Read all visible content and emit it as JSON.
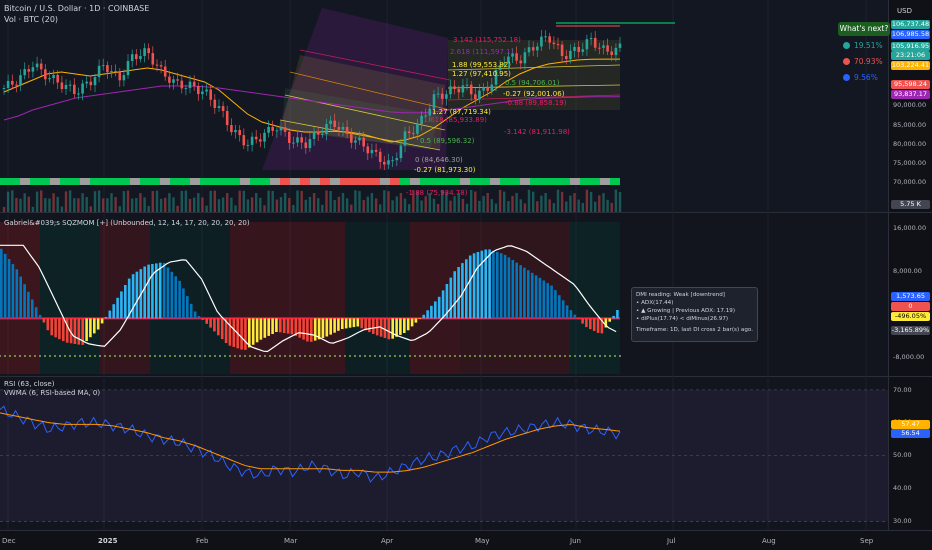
{
  "header": {
    "symbol_line": "Bitcoin / U.S. Dollar · 1D · COINBASE",
    "volume_label": "Vol · BTC (20)",
    "currency": "USD"
  },
  "whats_next": {
    "label": "What's next?",
    "scenarios": [
      {
        "label": "19.51%",
        "color": "#26a69a"
      },
      {
        "label": "70.93%",
        "color": "#ef5350"
      },
      {
        "label": "9.56%",
        "color": "#2962ff"
      }
    ]
  },
  "fib_levels": [
    {
      "label": "3.142 (115,752.18)",
      "color": "#e91e63"
    },
    {
      "label": "2.618 (111,597.1)",
      "color": "#9c27b0"
    },
    {
      "label": "1.88 (99,553.82)",
      "color": "#ffeb3b"
    },
    {
      "label": "1.27 (97,410.95)",
      "color": "#ffeb3b"
    },
    {
      "label": "0.5 (94,706.01)",
      "color": "#4caf50"
    },
    {
      "label": "-0.27 (92,001.06)",
      "color": "#ffeb3b"
    },
    {
      "label": "-0.88 (89,858.19)",
      "color": "#e91e63"
    },
    {
      "label": "1.27 (87,719.34)",
      "color": "#ffeb3b"
    },
    {
      "label": "-1.618 (85,933.89)",
      "color": "#e91e63"
    },
    {
      "label": "-3.142 (81,911.98)",
      "color": "#e91e63"
    },
    {
      "label": "0.5 (89,596.32)",
      "color": "#4caf50"
    },
    {
      "label": "0 (84,646.30)",
      "color": "#9e9e9e"
    },
    {
      "label": "-0.27 (81,973.30)",
      "color": "#ffeb3b"
    },
    {
      "label": "-1.88 (75,934.78)",
      "color": "#e91e63"
    }
  ],
  "price_axis": {
    "ticks": [
      "90,000.00",
      "85,000.00",
      "80,000.00",
      "75,000.00",
      "70,000.00"
    ],
    "tags": [
      {
        "label": "106,737.48",
        "color": "#26a69a"
      },
      {
        "label": "106,985.58",
        "color": "#2962ff"
      },
      {
        "label": "105,916.95",
        "color": "#26a69a"
      },
      {
        "label": "23:21:06",
        "color": "#26a69a"
      },
      {
        "label": "103,224.41",
        "color": "#ffb300"
      },
      {
        "label": "95,598.24",
        "color": "#ef5350"
      },
      {
        "label": "93,837.17",
        "color": "#9c27b0"
      },
      {
        "label": "5.75 K",
        "color": "#434651"
      }
    ]
  },
  "sqzmom": {
    "title": "Gabriel&#039;s SQZMOM [+] (Unbounded, 12, 14, 17, 20, 20, 20, 20)",
    "ticks": [
      "16,000.00",
      "8,000.00",
      "-8,000.00"
    ],
    "tags": [
      {
        "label": "1,573.65",
        "color": "#2962ff"
      },
      {
        "label": "0",
        "color": "#ef5350"
      },
      {
        "label": "-496.05%",
        "color": "#ffeb3b"
      },
      {
        "label": "-3,165.89%",
        "color": "#434651"
      }
    ],
    "dmi_box": {
      "line1": "DMI reading: Weak [downtrend]",
      "line2": "• ADX(17.44)",
      "line3": "• ▲ Growing | Previous ADX: 17.19)",
      "line4": "• diPlus(17.74) < diMinus(26.97)",
      "line5": "Timeframe: 1D, last DI cross 2 bar(s) ago."
    }
  },
  "rsi": {
    "title": "RSI (63, close)",
    "subtitle": "VWMA (6, RSI-based MA, 0)",
    "ticks": [
      "70.00",
      "60.00",
      "50.00",
      "40.00",
      "30.00"
    ],
    "tags": [
      {
        "label": "57.47",
        "color": "#ffb300"
      },
      {
        "label": "56.54",
        "color": "#2962ff"
      }
    ]
  },
  "time_axis": [
    "Dec",
    "2025",
    "Feb",
    "Mar",
    "Apr",
    "May",
    "Jun",
    "Jul",
    "Aug",
    "Sep"
  ],
  "chart_data": [
    {
      "type": "line",
      "name": "Bitcoin / U.S. Dollar daily",
      "x": [
        "Dec",
        "2025",
        "Feb",
        "Mar",
        "Apr",
        "May",
        "Jun",
        "Jul"
      ],
      "series": [
        {
          "values": [
            96000,
            98000,
            102000,
            99000,
            97000,
            95000,
            97500,
            102000,
            98000,
            104000,
            105000,
            100000,
            97000,
            96500,
            95000,
            91000,
            85000,
            82000,
            84000,
            86500,
            83000,
            82000,
            85000,
            87500,
            84000,
            82000,
            79000,
            76500,
            84000,
            87000,
            93500,
            95000,
            96500,
            94000,
            97000,
            104000,
            103000,
            106500,
            109000,
            104000,
            105500,
            108000,
            105000,
            106000
          ]
        },
        {
          "values": [
            95000,
            96500,
            98000,
            99500,
            100000,
            99500,
            99000,
            99500,
            100000,
            100500,
            101000,
            100500,
            99500,
            98500,
            97500,
            95500,
            92500,
            89500,
            87500,
            86500,
            85500,
            85000,
            85000,
            85200,
            85000,
            84500,
            83500,
            82500,
            83000,
            84000,
            86000,
            88500,
            91000,
            93000,
            95000,
            97500,
            99500,
            101000,
            102000,
            102500,
            103000,
            103200,
            103224,
            103224
          ]
        },
        {
          "values": [
            88000,
            89000,
            90500,
            91500,
            92500,
            93500,
            94000,
            94500,
            95000,
            95500,
            96000,
            96500,
            96500,
            96500,
            96300,
            96000,
            95500,
            95000,
            94500,
            94000,
            93500,
            93000,
            92500,
            92000,
            91500,
            91000,
            90500,
            90000,
            89800,
            89800,
            90000,
            90500,
            91000,
            91500,
            92000,
            92500,
            93000,
            93300,
            93500,
            93600,
            93700,
            93800,
            93837,
            93837
          ]
        }
      ],
      "ylim": [
        65000,
        118000
      ],
      "ylabel": "USD"
    },
    {
      "type": "bar",
      "name": "Gabriel's SQZMOM",
      "values": [
        13000,
        9000,
        3000,
        -3000,
        -4500,
        -5000,
        -2000,
        3000,
        8000,
        10000,
        10500,
        7000,
        1000,
        -2000,
        -5000,
        -6000,
        -4000,
        -2500,
        -3000,
        -4500,
        -3500,
        -2000,
        -1500,
        -3000,
        -4000,
        -2500,
        500,
        4000,
        9000,
        12000,
        13000,
        12000,
        10000,
        8000,
        6000,
        2000,
        -1500,
        -3000,
        1573
      ],
      "ylim": [
        -10000,
        18000
      ]
    },
    {
      "type": "line",
      "name": "RSI",
      "series": [
        {
          "values": [
            64,
            62,
            60,
            58,
            59,
            60,
            60,
            59,
            58,
            56,
            55,
            54,
            52,
            50,
            47,
            45,
            44,
            46,
            45,
            47,
            46,
            44,
            45,
            43,
            45,
            47,
            49,
            50,
            52,
            53,
            56,
            57,
            58,
            59,
            60,
            59.5,
            58,
            57.5,
            56.5
          ]
        },
        {
          "values": [
            63,
            62,
            61,
            60,
            59.5,
            59.5,
            59.5,
            59,
            58,
            57,
            55.5,
            54.5,
            53,
            51,
            49,
            47,
            46,
            46,
            46,
            46,
            46,
            45.5,
            45.5,
            45,
            45,
            45.5,
            46.5,
            48,
            49.5,
            51,
            53,
            55,
            56.5,
            58,
            59,
            59.5,
            58.5,
            58,
            57.47
          ]
        }
      ],
      "ylim": [
        28,
        73
      ]
    }
  ]
}
